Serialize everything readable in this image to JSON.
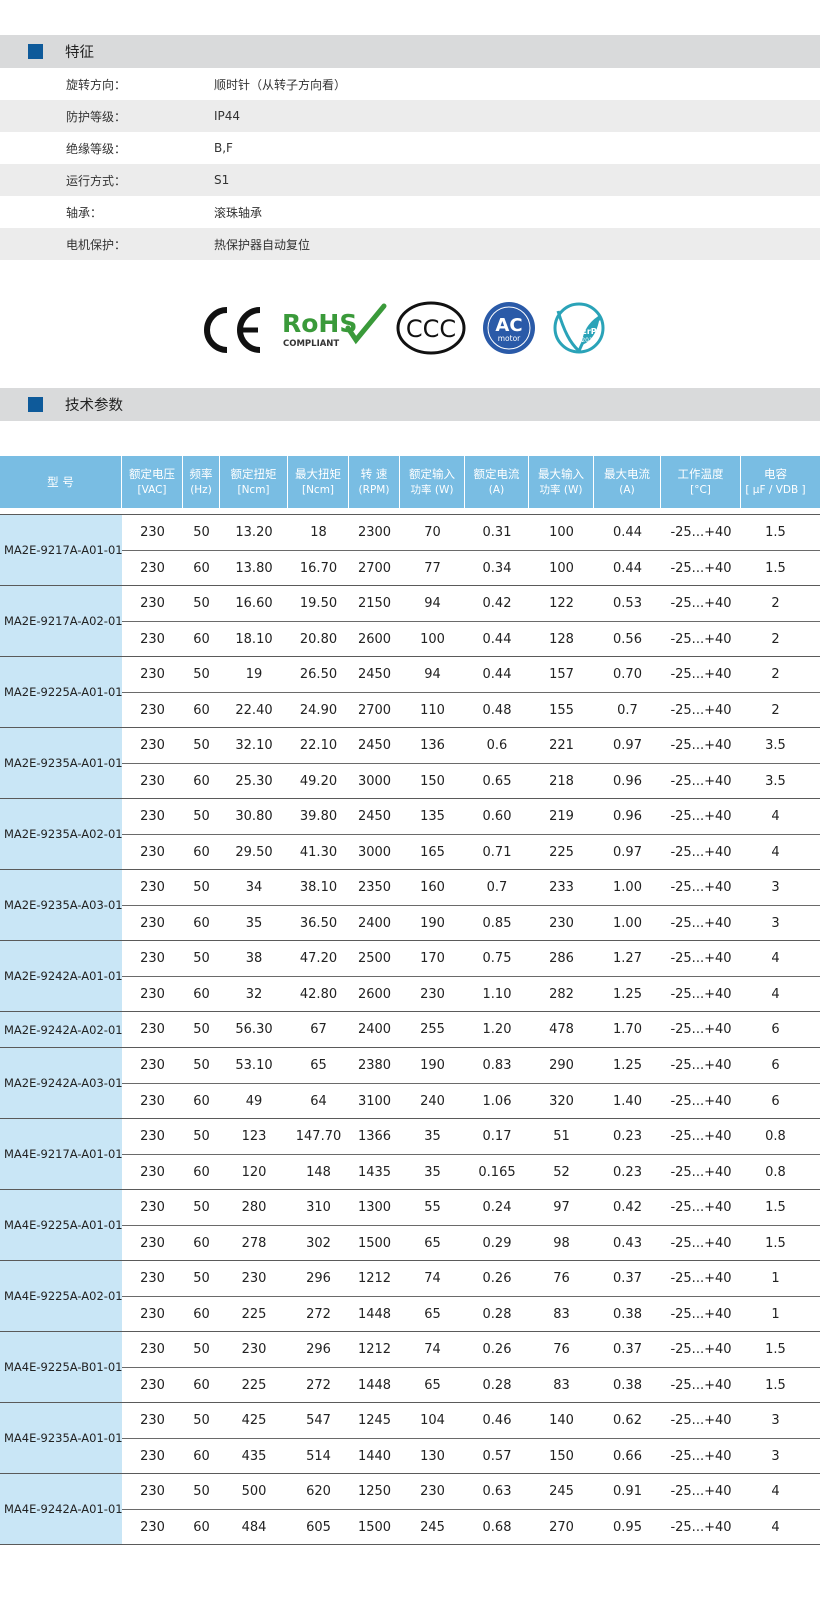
{
  "features": {
    "heading": "特征",
    "rows": [
      {
        "label": "旋转方向：",
        "value": "顺时针（从转子方向看）"
      },
      {
        "label": "防护等级：",
        "value": "IP44"
      },
      {
        "label": "绝缘等级：",
        "value": "B,F"
      },
      {
        "label": "运行方式：",
        "value": "S1"
      },
      {
        "label": "轴承：",
        "value": "滚珠轴承"
      },
      {
        "label": "电机保护：",
        "value": "热保护器自动复位"
      }
    ]
  },
  "certifications": {
    "ce": "CE",
    "rohs": "RoHS",
    "rohs_sub": "COMPLIANT",
    "ccc": "CCC",
    "ac": "AC",
    "ac_sub": "motor",
    "erp": "ErP",
    "erp_sub": "2015"
  },
  "specs": {
    "heading": "技术参数",
    "columns": [
      {
        "l1": "型 号",
        "l2": ""
      },
      {
        "l1": "额定电压",
        "l2": "[VAC]"
      },
      {
        "l1": "频率",
        "l2": "(Hz)"
      },
      {
        "l1": "额定扭矩",
        "l2": "[Ncm]"
      },
      {
        "l1": "最大扭矩",
        "l2": "[Ncm]"
      },
      {
        "l1": "转 速",
        "l2": "(RPM)"
      },
      {
        "l1": "额定输入",
        "l2": "功率 (W)"
      },
      {
        "l1": "额定电流",
        "l2": "(A)"
      },
      {
        "l1": "最大输入",
        "l2": "功率 (W)"
      },
      {
        "l1": "最大电流",
        "l2": "(A)"
      },
      {
        "l1": "工作温度",
        "l2": "[°C]"
      },
      {
        "l1": "电容",
        "l2": "[ µF / VDB ]"
      }
    ],
    "groups": [
      {
        "model": "MA2E-9217A-A01-01",
        "rows": [
          [
            "230",
            "50",
            "13.20",
            "18",
            "2300",
            "70",
            "0.31",
            "100",
            "0.44",
            "-25...+40",
            "1.5"
          ],
          [
            "230",
            "60",
            "13.80",
            "16.70",
            "2700",
            "77",
            "0.34",
            "100",
            "0.44",
            "-25...+40",
            "1.5"
          ]
        ]
      },
      {
        "model": "MA2E-9217A-A02-01",
        "rows": [
          [
            "230",
            "50",
            "16.60",
            "19.50",
            "2150",
            "94",
            "0.42",
            "122",
            "0.53",
            "-25...+40",
            "2"
          ],
          [
            "230",
            "60",
            "18.10",
            "20.80",
            "2600",
            "100",
            "0.44",
            "128",
            "0.56",
            "-25...+40",
            "2"
          ]
        ]
      },
      {
        "model": "MA2E-9225A-A01-01",
        "rows": [
          [
            "230",
            "50",
            "19",
            "26.50",
            "2450",
            "94",
            "0.44",
            "157",
            "0.70",
            "-25...+40",
            "2"
          ],
          [
            "230",
            "60",
            "22.40",
            "24.90",
            "2700",
            "110",
            "0.48",
            "155",
            "0.7",
            "-25...+40",
            "2"
          ]
        ]
      },
      {
        "model": "MA2E-9235A-A01-01",
        "rows": [
          [
            "230",
            "50",
            "32.10",
            "22.10",
            "2450",
            "136",
            "0.6",
            "221",
            "0.97",
            "-25...+40",
            "3.5"
          ],
          [
            "230",
            "60",
            "25.30",
            "49.20",
            "3000",
            "150",
            "0.65",
            "218",
            "0.96",
            "-25...+40",
            "3.5"
          ]
        ]
      },
      {
        "model": "MA2E-9235A-A02-01",
        "rows": [
          [
            "230",
            "50",
            "30.80",
            "39.80",
            "2450",
            "135",
            "0.60",
            "219",
            "0.96",
            "-25...+40",
            "4"
          ],
          [
            "230",
            "60",
            "29.50",
            "41.30",
            "3000",
            "165",
            "0.71",
            "225",
            "0.97",
            "-25...+40",
            "4"
          ]
        ]
      },
      {
        "model": "MA2E-9235A-A03-01",
        "rows": [
          [
            "230",
            "50",
            "34",
            "38.10",
            "2350",
            "160",
            "0.7",
            "233",
            "1.00",
            "-25...+40",
            "3"
          ],
          [
            "230",
            "60",
            "35",
            "36.50",
            "2400",
            "190",
            "0.85",
            "230",
            "1.00",
            "-25...+40",
            "3"
          ]
        ]
      },
      {
        "model": "MA2E-9242A-A01-01",
        "rows": [
          [
            "230",
            "50",
            "38",
            "47.20",
            "2500",
            "170",
            "0.75",
            "286",
            "1.27",
            "-25...+40",
            "4"
          ],
          [
            "230",
            "60",
            "32",
            "42.80",
            "2600",
            "230",
            "1.10",
            "282",
            "1.25",
            "-25...+40",
            "4"
          ]
        ]
      },
      {
        "model": "MA2E-9242A-A02-01",
        "rows": [
          [
            "230",
            "50",
            "56.30",
            "67",
            "2400",
            "255",
            "1.20",
            "478",
            "1.70",
            "-25...+40",
            "6"
          ]
        ]
      },
      {
        "model": "MA2E-9242A-A03-01",
        "rows": [
          [
            "230",
            "50",
            "53.10",
            "65",
            "2380",
            "190",
            "0.83",
            "290",
            "1.25",
            "-25...+40",
            "6"
          ],
          [
            "230",
            "60",
            "49",
            "64",
            "3100",
            "240",
            "1.06",
            "320",
            "1.40",
            "-25...+40",
            "6"
          ]
        ]
      },
      {
        "model": "MA4E-9217A-A01-01",
        "rows": [
          [
            "230",
            "50",
            "123",
            "147.70",
            "1366",
            "35",
            "0.17",
            "51",
            "0.23",
            "-25...+40",
            "0.8"
          ],
          [
            "230",
            "60",
            "120",
            "148",
            "1435",
            "35",
            "0.165",
            "52",
            "0.23",
            "-25...+40",
            "0.8"
          ]
        ]
      },
      {
        "model": "MA4E-9225A-A01-01",
        "rows": [
          [
            "230",
            "50",
            "280",
            "310",
            "1300",
            "55",
            "0.24",
            "97",
            "0.42",
            "-25...+40",
            "1.5"
          ],
          [
            "230",
            "60",
            "278",
            "302",
            "1500",
            "65",
            "0.29",
            "98",
            "0.43",
            "-25...+40",
            "1.5"
          ]
        ]
      },
      {
        "model": "MA4E-9225A-A02-01",
        "rows": [
          [
            "230",
            "50",
            "230",
            "296",
            "1212",
            "74",
            "0.26",
            "76",
            "0.37",
            "-25...+40",
            "1"
          ],
          [
            "230",
            "60",
            "225",
            "272",
            "1448",
            "65",
            "0.28",
            "83",
            "0.38",
            "-25...+40",
            "1"
          ]
        ]
      },
      {
        "model": "MA4E-9225A-B01-01",
        "rows": [
          [
            "230",
            "50",
            "230",
            "296",
            "1212",
            "74",
            "0.26",
            "76",
            "0.37",
            "-25...+40",
            "1.5"
          ],
          [
            "230",
            "60",
            "225",
            "272",
            "1448",
            "65",
            "0.28",
            "83",
            "0.38",
            "-25...+40",
            "1.5"
          ]
        ]
      },
      {
        "model": "MA4E-9235A-A01-01",
        "rows": [
          [
            "230",
            "50",
            "425",
            "547",
            "1245",
            "104",
            "0.46",
            "140",
            "0.62",
            "-25...+40",
            "3"
          ],
          [
            "230",
            "60",
            "435",
            "514",
            "1440",
            "130",
            "0.57",
            "150",
            "0.66",
            "-25...+40",
            "3"
          ]
        ]
      },
      {
        "model": "MA4E-9242A-A01-01",
        "rows": [
          [
            "230",
            "50",
            "500",
            "620",
            "1250",
            "230",
            "0.63",
            "245",
            "0.91",
            "-25...+40",
            "4"
          ],
          [
            "230",
            "60",
            "484",
            "605",
            "1500",
            "245",
            "0.68",
            "270",
            "0.95",
            "-25...+40",
            "4"
          ]
        ]
      }
    ]
  }
}
